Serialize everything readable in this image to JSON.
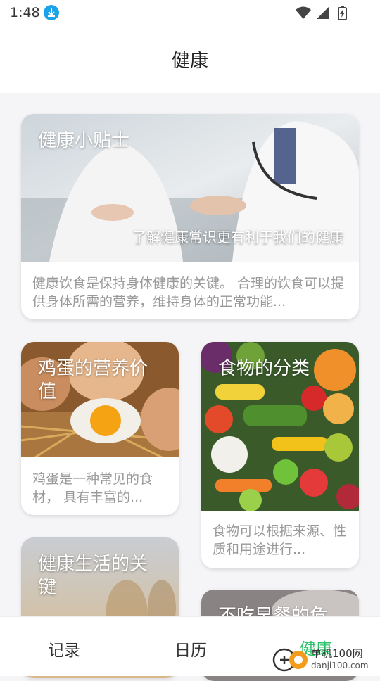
{
  "status_bar": {
    "time": "1:48"
  },
  "header": {
    "title": "健康"
  },
  "cards": [
    {
      "title": "健康小贴士",
      "subtitle": "了解健康常识更有利于我们的健康",
      "desc": "健康饮食是保持身体健康的关键。 合理的饮食可以提供身体所需的营养，维持身体的正常功能..."
    },
    {
      "title": "鸡蛋的营养价值",
      "desc": "鸡蛋是一种常见的食材， 具有丰富的..."
    },
    {
      "title": "食物的分类",
      "desc": "食物可以根据来源、性质和用途进行..."
    },
    {
      "title": "健康生活的关键"
    },
    {
      "title": "不吃早餐的危"
    }
  ],
  "nav": {
    "items": [
      {
        "label": "记录"
      },
      {
        "label": "日历"
      },
      {
        "label": "健康"
      }
    ],
    "active_color": "#2cc26b"
  },
  "watermark": {
    "name": "单机100网",
    "domain": "danji100.com"
  }
}
